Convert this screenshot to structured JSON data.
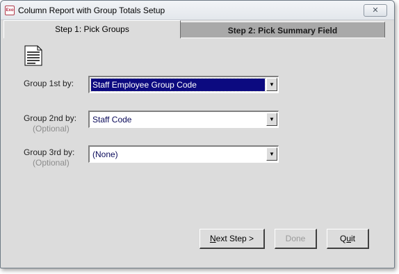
{
  "window": {
    "title": "Column Report with Group Totals Setup",
    "app_icon_text": "Exo",
    "close_glyph": "✕"
  },
  "tabs": [
    {
      "label": "Step 1: Pick Groups",
      "active": true
    },
    {
      "label": "Step 2: Pick Summary Field",
      "active": false
    }
  ],
  "icons": {
    "report": "report-document-icon",
    "dropdown": "chevron-down-icon"
  },
  "groups": [
    {
      "label": "Group 1st by:",
      "optional": "",
      "value": "Staff Employee Group Code",
      "focused": true
    },
    {
      "label": "Group 2nd by:",
      "optional": "(Optional)",
      "value": "Staff Code",
      "focused": false
    },
    {
      "label": "Group 3rd by:",
      "optional": "(Optional)",
      "value": "(None)",
      "focused": false
    }
  ],
  "buttons": {
    "next_mnemonic": "N",
    "next_rest": "ext Step >",
    "done_label": "Done",
    "quit_prefix": "Q",
    "quit_mnemonic": "u",
    "quit_rest": "it"
  },
  "colors": {
    "selection": "#0c0a80",
    "face": "#dcdcdc"
  }
}
